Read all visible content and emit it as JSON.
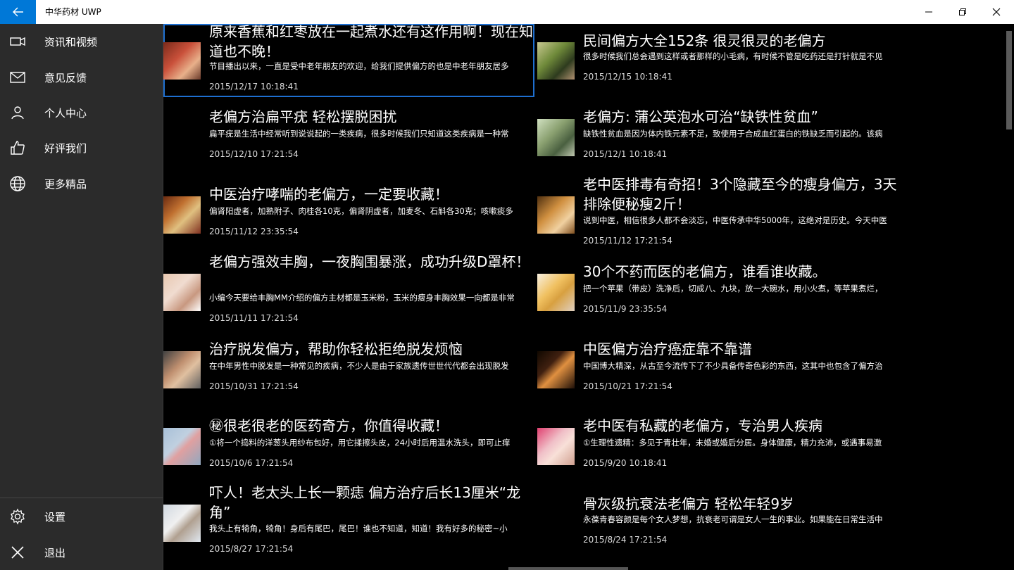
{
  "window": {
    "title": "中华药材 UWP",
    "accent": "#0078d7"
  },
  "sidebar": {
    "items": [
      {
        "label": "资讯和视频",
        "icon": "video-camera-icon"
      },
      {
        "label": "意见反馈",
        "icon": "mail-icon"
      },
      {
        "label": "个人中心",
        "icon": "person-icon"
      },
      {
        "label": "好评我们",
        "icon": "thumbs-up-icon"
      },
      {
        "label": "更多精品",
        "icon": "globe-icon"
      }
    ],
    "bottom": [
      {
        "label": "设置",
        "icon": "gear-icon"
      },
      {
        "label": "退出",
        "icon": "close-icon"
      }
    ]
  },
  "articles": [
    {
      "title": "原来香蕉和红枣放在一起煮水还有这作用啊！现在知道也不晚！",
      "summary": "节目播出以来，一直是受中老年朋友的欢迎，给我们提供偏方的也是中老年朋友居多",
      "date": "2015/12/17 10:18:41",
      "thumb": "woman-red"
    },
    {
      "title": "民间偏方大全152条 很灵很灵的老偏方",
      "summary": "很多时候我们总会遇到这样或者那样的小毛病，有时候不管是吃药还是打针就是不见",
      "date": "2015/12/15 10:18:41",
      "thumb": "woman-green"
    },
    {
      "title": "老偏方治扁平疣  轻松摆脱困扰",
      "summary": "扁平疣是生活中经常听到说说起的一类疾病，很多时候我们只知道这类疾病是一种常",
      "date": "2015/12/10 17:21:54",
      "thumb": "none"
    },
    {
      "title": "老偏方: 蒲公英泡水可治“缺铁性贫血”",
      "summary": "缺铁性贫血是因为体内铁元素不足，致使用于合成血红蛋白的铁缺乏而引起的。该病",
      "date": "2015/12/1 10:18:41",
      "thumb": "herb-tea"
    },
    {
      "title": "中医治疗哮喘的老偏方，一定要收藏！",
      "summary": "偏肾阳虚者，加熟附子、肉桂各10克，偏肾阴虚者，加麦冬、石斛各30克；咳嗽痰多",
      "date": "2015/11/12 23:35:54",
      "thumb": "spices"
    },
    {
      "title": "老中医排毒有奇招！3个隐藏至今的瘦身偏方，3天排除便秘瘦2斤！",
      "summary": "说到中医，相信很多人都不会淡忘，中医传承中华5000年，这绝对是历史。今天中医",
      "date": "2015/11/12 17:21:54",
      "thumb": "food"
    },
    {
      "title": "老偏方强效丰胸，一夜胸围暴涨，成功升级D罩杯！",
      "summary": "小编今天要给丰胸MM介绍的偏方主材都是玉米粉，玉米的瘦身丰胸效果一向都是非常",
      "date": "2015/11/11 17:21:54",
      "thumb": "skin"
    },
    {
      "title": "30个不药而医的老偏方，谁看谁收藏。",
      "summary": "把一个苹果（带皮）洗净后，切成八、九块，放一大碗水，用小火煮，等苹果煮烂，",
      "date": "2015/11/9 23:35:54",
      "thumb": "drink"
    },
    {
      "title": "治疗脱发偏方，帮助你轻松拒绝脱发烦恼",
      "summary": "在中年男性中脱发是一种常见的疾病，不少人是由于家族遗传世世代代都会出现脱发",
      "date": "2015/10/31 17:21:54",
      "thumb": "man"
    },
    {
      "title": "中医偏方治疗癌症靠不靠谱",
      "summary": "中国博大精深，从古至今流传下了不少具备传奇色彩的东西，这其中也包含了偏方治",
      "date": "2015/10/21 17:21:54",
      "thumb": "candle"
    },
    {
      "title": "㊙很老很老的医药奇方，你值得收藏！",
      "summary": "①将一个捣料的洋葱头用纱布包好，用它揉擦头皮，24小时后用温水洗头，即可止痒",
      "date": "2015/10/6 17:21:54",
      "thumb": "flower"
    },
    {
      "title": "老中医有私藏的老偏方，专治男人疾病",
      "summary": "①生理性遗精：多见于青壮年，未婚或婚后分居。身体健康，精力充沛，或遇事易激",
      "date": "2015/9/20 10:18:41",
      "thumb": "hand"
    },
    {
      "title": "吓人！老太头上长一颗痣 偏方治疗后长13厘米“龙角”",
      "summary": "我头上有犄角，犄角！身后有尾巴，尾巴！谁也不知道，知道！我有好多的秘密~小",
      "date": "2015/8/27 17:21:54",
      "thumb": "doctor"
    },
    {
      "title": "骨灰级抗衰法老偏方 轻松年轻9岁",
      "summary": "永葆青春容颜是每个女人梦想，抗衰老可谓是女人一生的事业。如果能在日常生活中",
      "date": "2015/8/24 17:21:54",
      "thumb": "none"
    }
  ]
}
